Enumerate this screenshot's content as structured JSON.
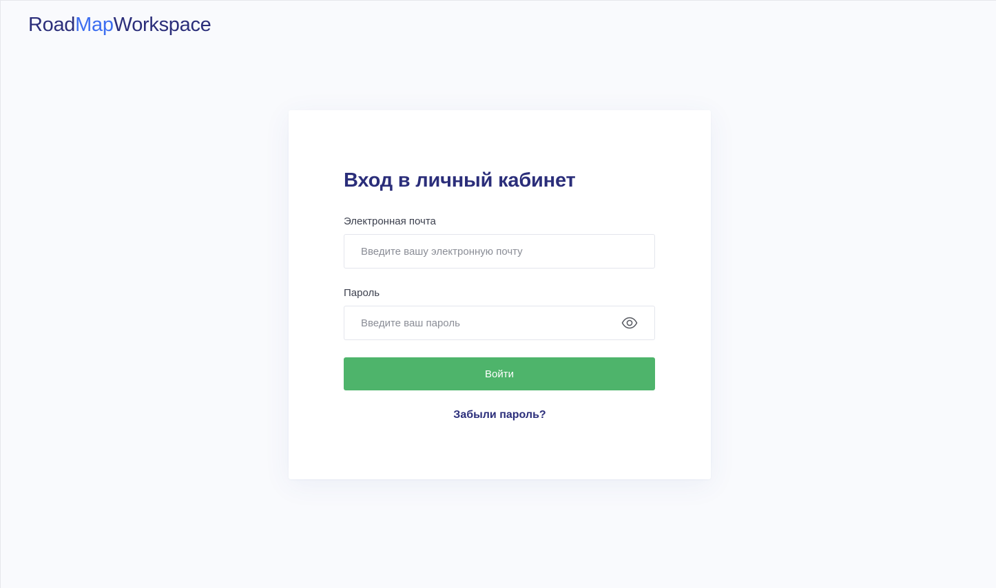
{
  "brand": {
    "part1": "Road",
    "part2": "Map",
    "part3": "Workspace",
    "color_primary": "#2b2e7a",
    "color_accent": "#3d6ef0"
  },
  "login": {
    "title": "Вход в личный кабинет",
    "email_label": "Электронная почта",
    "email_placeholder": "Введите вашу электронную почту",
    "email_value": "",
    "password_label": "Пароль",
    "password_placeholder": "Введите ваш пароль",
    "password_value": "",
    "password_toggle_icon": "eye-icon",
    "submit_label": "Войти",
    "submit_color": "#4eb46b",
    "forgot_label": "Забыли пароль?"
  }
}
